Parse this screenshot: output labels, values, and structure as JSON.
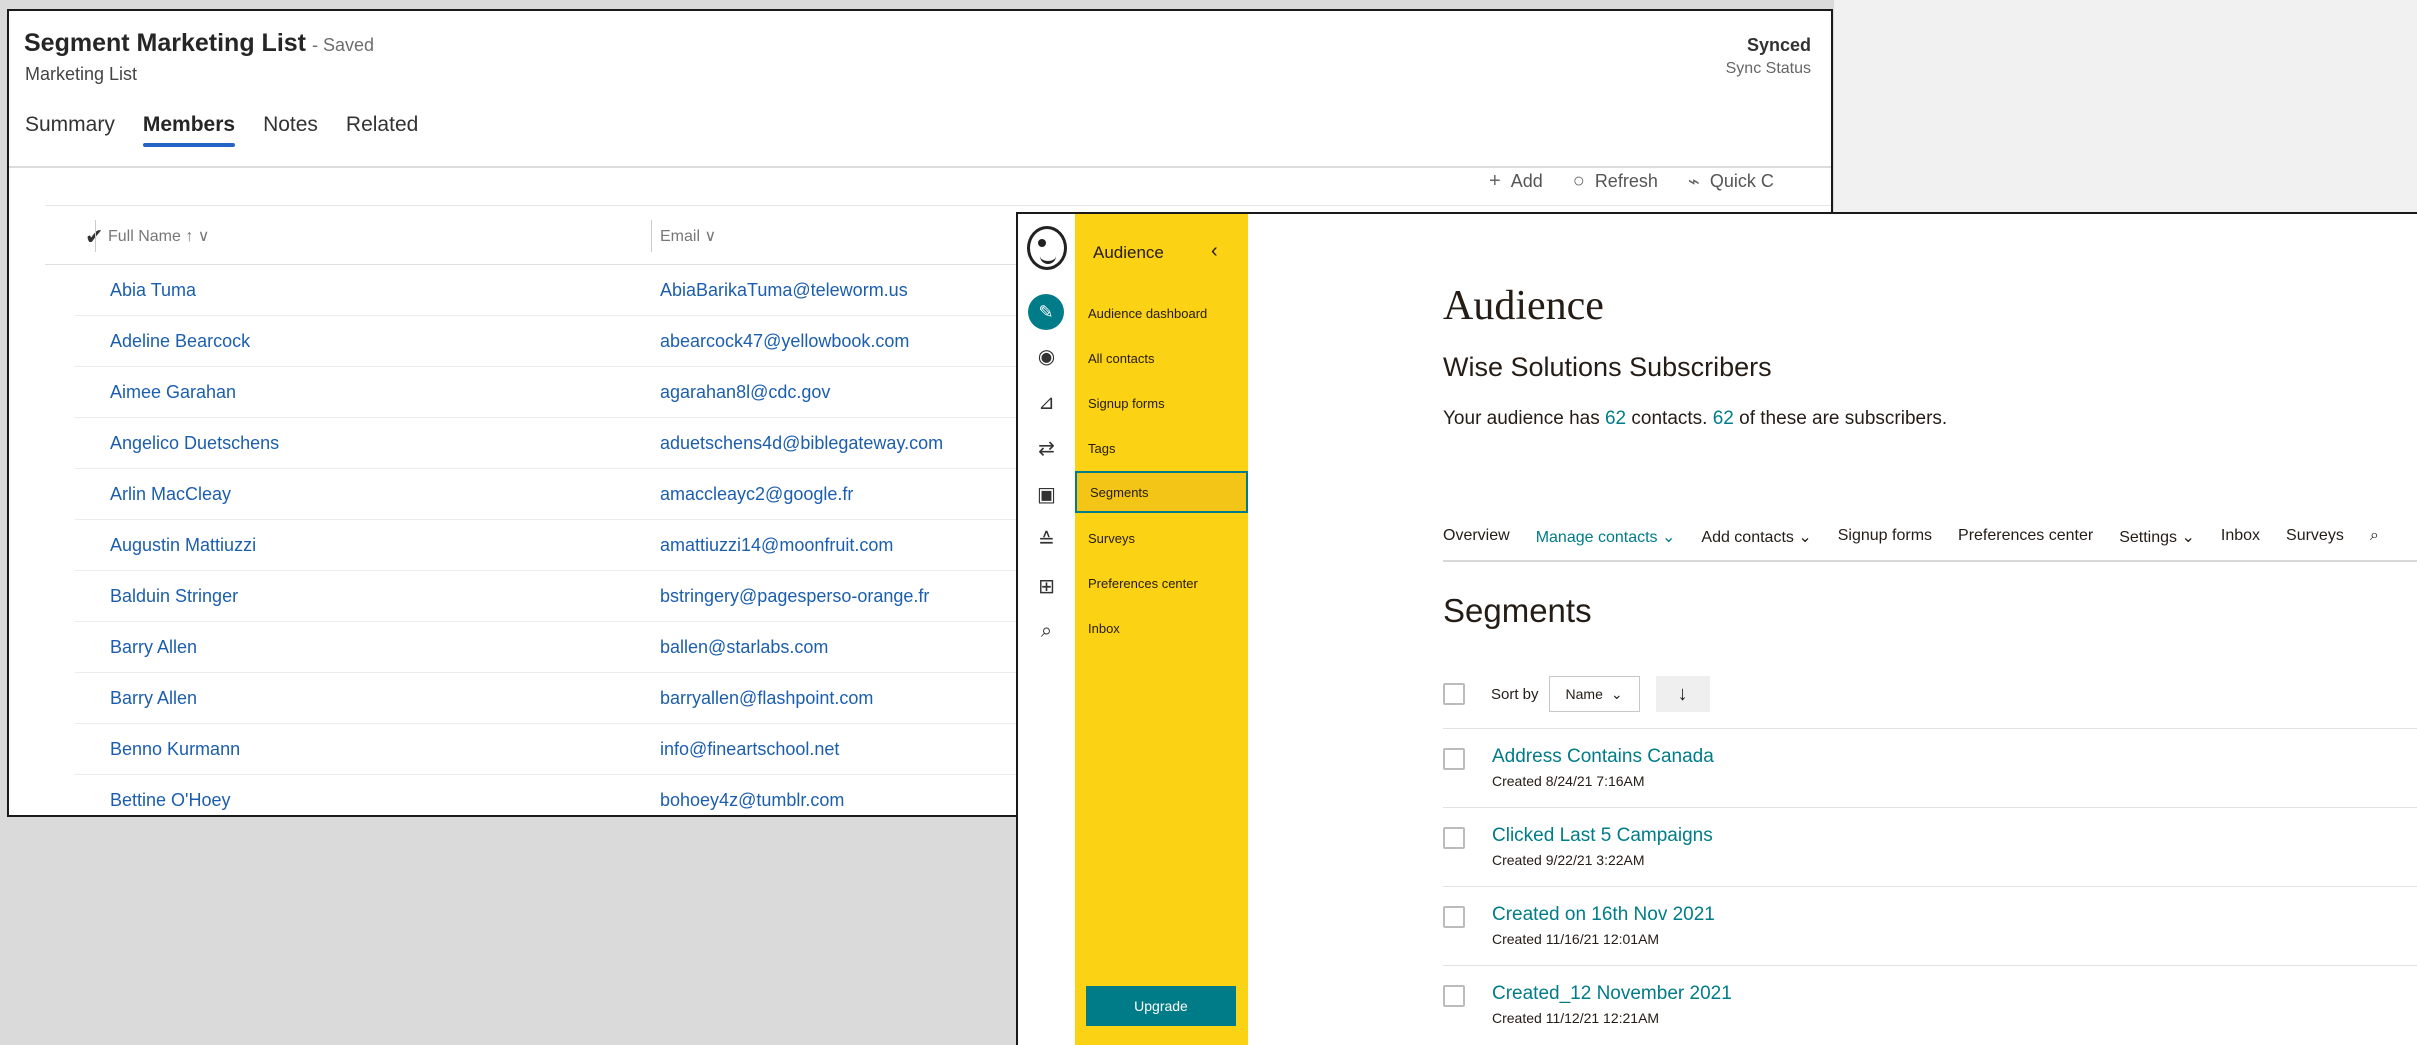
{
  "crm": {
    "title": "Segment Marketing List",
    "saved": "- Saved",
    "subtitle": "Marketing List",
    "sync_value": "Synced",
    "sync_label": "Sync Status",
    "tabs": [
      "Summary",
      "Members",
      "Notes",
      "Related"
    ],
    "active_tab": "Members",
    "commands": [
      {
        "icon": "plus-icon",
        "label": "Add"
      },
      {
        "icon": "refresh-icon",
        "label": "Refresh"
      },
      {
        "icon": "quick-create-icon",
        "label": "Quick C"
      }
    ],
    "columns": {
      "name": "Full Name ↑ ∨",
      "email": "Email ∨"
    },
    "rows": [
      {
        "name": "Abia Tuma",
        "email": "AbiaBarikaTuma@teleworm.us"
      },
      {
        "name": "Adeline Bearcock",
        "email": "abearcock47@yellowbook.com"
      },
      {
        "name": "Aimee Garahan",
        "email": "agarahan8l@cdc.gov"
      },
      {
        "name": "Angelico Duetschens",
        "email": "aduetschens4d@biblegateway.com"
      },
      {
        "name": "Arlin MacCleay",
        "email": "amaccleayc2@google.fr"
      },
      {
        "name": "Augustin Mattiuzzi",
        "email": "amattiuzzi14@moonfruit.com"
      },
      {
        "name": "Balduin Stringer",
        "email": "bstringery@pagesperso-orange.fr"
      },
      {
        "name": "Barry Allen",
        "email": "ballen@starlabs.com"
      },
      {
        "name": "Barry Allen",
        "email": "barryallen@flashpoint.com"
      },
      {
        "name": "Benno Kurmann",
        "email": "info@fineartschool.net"
      },
      {
        "name": "Bettine O'Hoey",
        "email": "bohoey4z@tumblr.com"
      }
    ]
  },
  "mc": {
    "sidebar_title": "Audience",
    "sidebar_items": [
      "Audience dashboard",
      "All contacts",
      "Signup forms",
      "Tags",
      "Segments",
      "Surveys",
      "Preferences center",
      "Inbox"
    ],
    "active_item": "Segments",
    "upgrade": "Upgrade",
    "heading": "Audience",
    "list_name": "Wise Solutions Subscribers",
    "summary": {
      "pre": "Your audience has ",
      "contacts": "62",
      "mid": " contacts. ",
      "subscribers": "62",
      "post": " of these are subscribers."
    },
    "nav": [
      "Overview",
      "Manage contacts ⌄",
      "Add contacts ⌄",
      "Signup forms",
      "Preferences center",
      "Settings ⌄",
      "Inbox",
      "Surveys"
    ],
    "segments_heading": "Segments",
    "sort_label": "Sort by",
    "sort_value": "Name",
    "sort_dir": "↓",
    "segments": [
      {
        "name": "Address Contains Canada",
        "created": "Created 8/24/21 7:16AM"
      },
      {
        "name": "Clicked Last 5 Campaigns",
        "created": "Created 9/22/21 3:22AM"
      },
      {
        "name": "Created on 16th Nov 2021",
        "created": "Created 11/16/21 12:01AM"
      },
      {
        "name": "Created_12 November 2021",
        "created": "Created 11/12/21 12:21AM"
      }
    ]
  },
  "colors": {
    "accent_blue": "#2563c4",
    "link_blue": "#1c5eae",
    "mailchimp_yellow": "#fcd214",
    "mailchimp_teal": "#007c89"
  }
}
